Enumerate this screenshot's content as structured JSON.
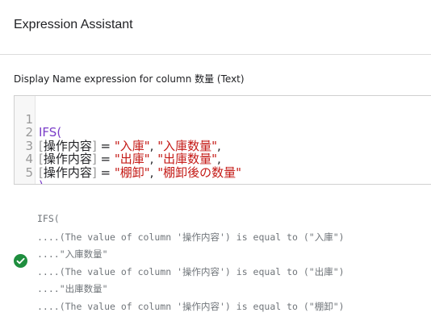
{
  "header": {
    "title": "Expression Assistant"
  },
  "field": {
    "label": "Display Name expression for column 数量 (Text)"
  },
  "editor": {
    "line_numbers": [
      "1",
      "2",
      "3",
      "4",
      "5"
    ],
    "lines": {
      "l1": {
        "func": "IFS",
        "open": "("
      },
      "l2": {
        "open_bracket": "[",
        "column": "操作内容",
        "close_bracket": "]",
        "op": " = ",
        "value": "\"入庫\"",
        "comma1": ", ",
        "result": "\"入庫数量\"",
        "comma2": ","
      },
      "l3": {
        "open_bracket": "[",
        "column": "操作内容",
        "close_bracket": "]",
        "op": " = ",
        "value": "\"出庫\"",
        "comma1": ", ",
        "result": "\"出庫数量\"",
        "comma2": ","
      },
      "l4": {
        "open_bracket": "[",
        "column": "操作内容",
        "close_bracket": "]",
        "op": " = ",
        "value": "\"棚卸\"",
        "comma1": ", ",
        "result": "\"棚卸後の数量\""
      },
      "l5": {
        "close": ")"
      }
    },
    "colors": {
      "function": "#7a3dc8",
      "string": "#c41a16",
      "bracket": "#999999"
    }
  },
  "result": {
    "status_icon": "check-circle-icon",
    "status_color": "#1e8e3e",
    "lines": [
      "IFS(",
      "....(The value of column '操作内容') is equal to (\"入庫\")",
      "....\"入庫数量\"",
      "....(The value of column '操作内容') is equal to (\"出庫\")",
      "....\"出庫数量\"",
      "....(The value of column '操作内容') is equal to (\"棚卸\")"
    ]
  }
}
